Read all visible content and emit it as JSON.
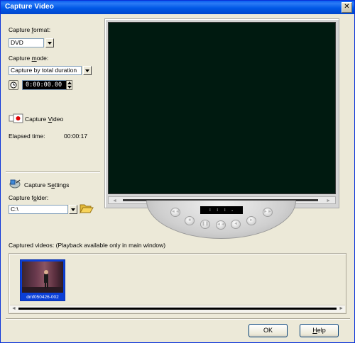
{
  "window": {
    "title": "Capture Video",
    "close_glyph": "✕"
  },
  "capture_format": {
    "label_pre": "Capture ",
    "label_ul": "f",
    "label_post": "ormat:",
    "value": "DVD"
  },
  "capture_mode": {
    "label_pre": "Capture ",
    "label_ul": "m",
    "label_post": "ode:",
    "value": "Capture by total duration"
  },
  "duration": {
    "value": "0:00:00.00"
  },
  "capture_video": {
    "label_pre": "Capture ",
    "label_ul": "V",
    "label_post": "ideo"
  },
  "elapsed": {
    "label": "Elapsed time:",
    "value": "00:00:17"
  },
  "capture_settings": {
    "label_pre": "Capture S",
    "label_ul": "e",
    "label_post": "ttings"
  },
  "capture_folder": {
    "label_pre": "Capture f",
    "label_ul": "o",
    "label_post": "lder:",
    "value": "C:\\"
  },
  "player": {
    "timecode": ": : : ."
  },
  "captured": {
    "label": "Captured videos: (Playback available only in main window)",
    "items": [
      {
        "name": "dmf050426-002"
      }
    ]
  },
  "buttons": {
    "ok": "OK",
    "help_pre": "",
    "help_ul": "H",
    "help_post": "elp"
  },
  "colors": {
    "title_bar": "#0058e6",
    "selection": "#0b3fd6",
    "screen": "#001a10"
  }
}
